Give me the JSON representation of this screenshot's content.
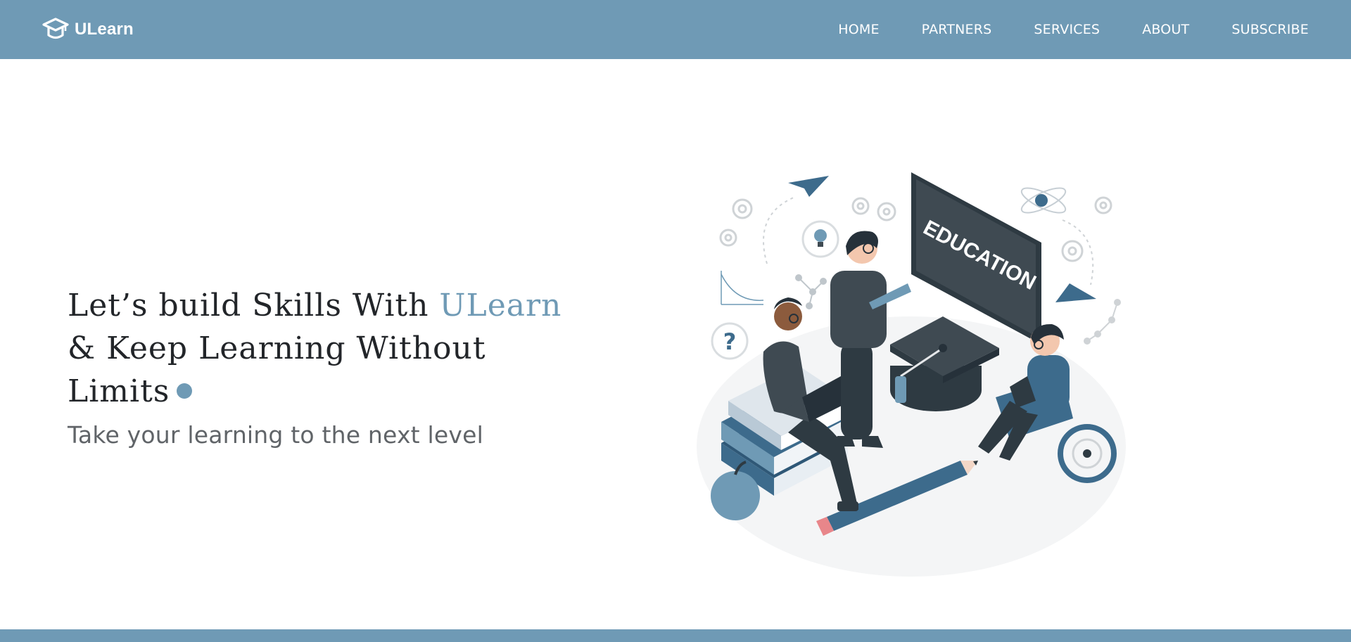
{
  "brand": {
    "name": "ULearn",
    "icon": "graduation-cap-icon"
  },
  "nav": {
    "items": [
      {
        "label": "HOME"
      },
      {
        "label": "PARTNERS"
      },
      {
        "label": "SERVICES"
      },
      {
        "label": "ABOUT"
      },
      {
        "label": "SUBSCRIBE"
      }
    ]
  },
  "hero": {
    "headline_prefix": "Let’s build Skills With ",
    "headline_accent": "ULearn",
    "headline_line2": "& Keep Learning Without",
    "headline_line3": "Limits",
    "subtitle": "Take your learning to the next level",
    "illustration": {
      "board_text": "EDUCATION",
      "question_mark": "?"
    }
  },
  "colors": {
    "accent": "#6f9ab5",
    "text_dark": "#222529",
    "text_muted": "#606468",
    "slate": "#3f4a52"
  }
}
